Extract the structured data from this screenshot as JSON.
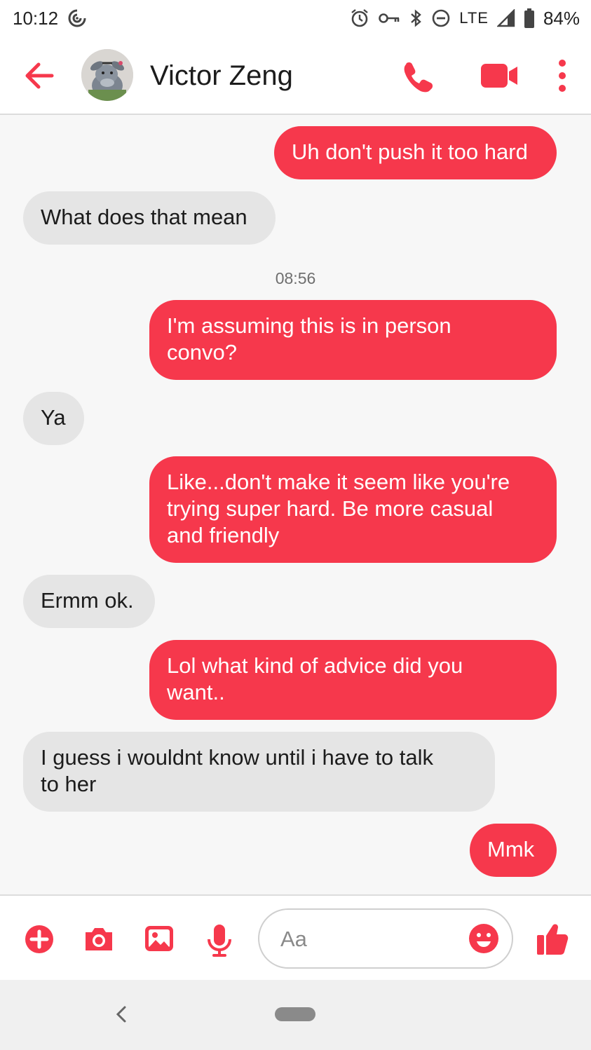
{
  "status_bar": {
    "time": "10:12",
    "network": "LTE",
    "battery": "84%"
  },
  "header": {
    "contact_name": "Victor Zeng"
  },
  "accent_color": "#f6384c",
  "messages": [
    {
      "direction": "outgoing",
      "text": "Uh don't push it too hard"
    },
    {
      "direction": "incoming",
      "text": "What does that mean"
    },
    {
      "direction": "outgoing",
      "lines": [
        "I'm assuming this is in person",
        "convo?"
      ]
    },
    {
      "direction": "incoming",
      "text": "Ya"
    },
    {
      "direction": "outgoing",
      "lines": [
        "Like...don't make it seem like you're",
        "trying super hard. Be more casual",
        "and friendly"
      ]
    },
    {
      "direction": "incoming",
      "text": "Ermm ok."
    },
    {
      "direction": "outgoing",
      "lines": [
        "Lol what kind of advice did you",
        "want.."
      ]
    },
    {
      "direction": "incoming",
      "lines": [
        "I guess i wouldnt know until i have to talk",
        "to her"
      ]
    },
    {
      "direction": "outgoing",
      "text": "Mmk"
    }
  ],
  "timestamp": "08:56",
  "composer": {
    "placeholder": "Aa",
    "icons": [
      "plus-icon",
      "camera-icon",
      "gallery-icon",
      "microphone-icon",
      "emoji-icon",
      "thumbs-up-icon"
    ]
  }
}
